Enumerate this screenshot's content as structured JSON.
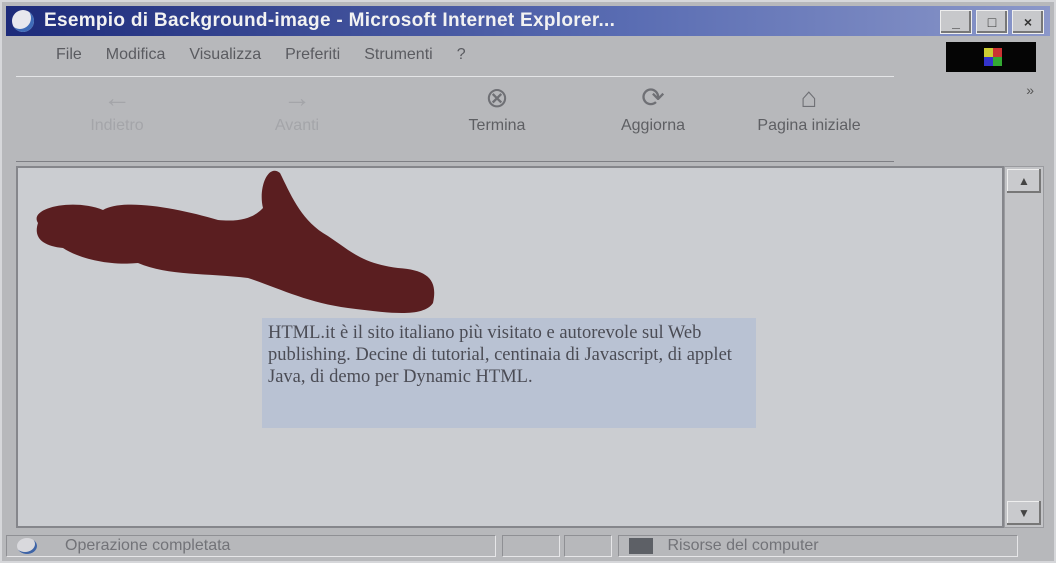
{
  "window": {
    "title": "Esempio di Background-image - Microsoft Internet Explorer...",
    "buttons": [
      "_",
      "□",
      "×"
    ]
  },
  "menubar": [
    "File",
    "Modifica",
    "Visualizza",
    "Preferiti",
    "Strumenti",
    "?"
  ],
  "toolbar": {
    "back": {
      "label": "Indietro",
      "icon": "back-arrow-icon"
    },
    "forward": {
      "label": "Avanti",
      "icon": "forward-arrow-icon"
    },
    "stop": {
      "label": "Termina",
      "icon": "stop-icon"
    },
    "refresh": {
      "label": "Aggiorna",
      "icon": "refresh-icon"
    },
    "home": {
      "label": "Pagina iniziale",
      "icon": "home-icon"
    }
  },
  "content": {
    "text": "HTML.it è il sito italiano più visitato e autorevole sul Web publishing. Decine di tutorial, centinaia di Javascript, di applet Java, di demo per Dynamic HTML.",
    "hand_color": "#5a1e20"
  },
  "statusbar": {
    "status_text": "Operazione completata",
    "zone_text": "Risorse del computer"
  }
}
